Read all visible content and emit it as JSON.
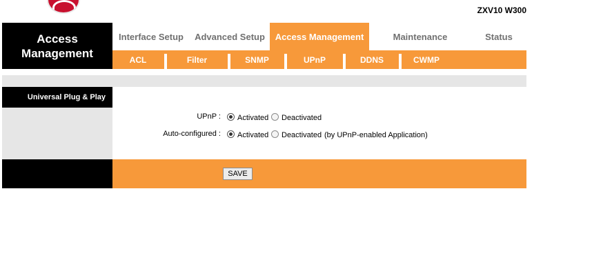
{
  "header": {
    "model": "ZXV10 W300",
    "section_title": "Access Management"
  },
  "main_nav": [
    {
      "label": "Interface Setup",
      "active": false
    },
    {
      "label": "Advanced Setup",
      "active": false
    },
    {
      "label": "Access Management",
      "active": true
    },
    {
      "label": "Maintenance",
      "active": false
    },
    {
      "label": "Status",
      "active": false
    }
  ],
  "sub_nav": [
    {
      "label": "ACL"
    },
    {
      "label": "Filter"
    },
    {
      "label": "SNMP"
    },
    {
      "label": "UPnP"
    },
    {
      "label": "DDNS"
    },
    {
      "label": "CWMP"
    }
  ],
  "section": {
    "label": "Universal Plug & Play"
  },
  "form": {
    "upnp": {
      "label": "UPnP :",
      "options": [
        "Activated",
        "Deactivated"
      ],
      "selected": "Activated"
    },
    "auto_configured": {
      "label": "Auto-configured :",
      "options": [
        "Activated",
        "Deactivated"
      ],
      "selected": "Activated",
      "note": "(by UPnP-enabled Application)"
    }
  },
  "actions": {
    "save_label": "SAVE"
  },
  "colors": {
    "accent": "#f7993a",
    "dark": "#000000",
    "panel_gray": "#e6e6e6",
    "brand_red": "#c8102e"
  }
}
